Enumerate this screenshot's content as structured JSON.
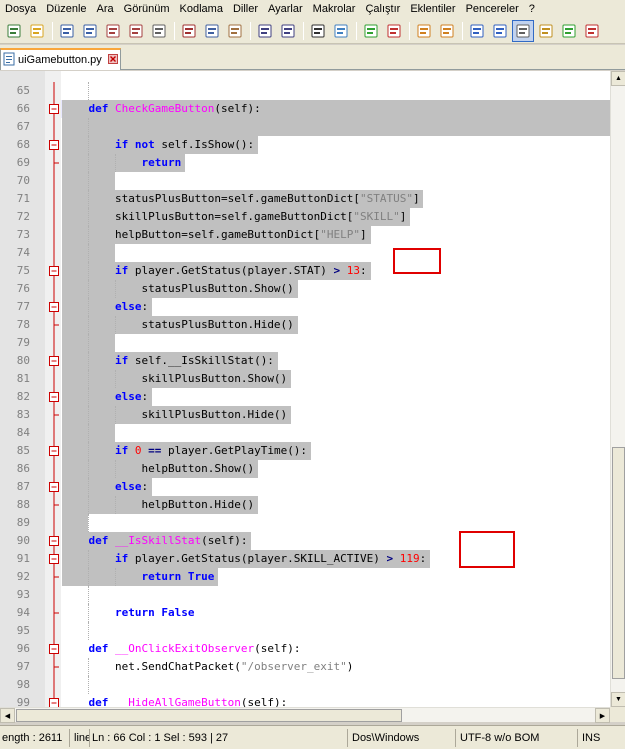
{
  "menu": [
    "Dosya",
    "Düzenle",
    "Ara",
    "Görünüm",
    "Kodlama",
    "Diller",
    "Ayarlar",
    "Makrolar",
    "Çalıştır",
    "Eklentiler",
    "Pencereler",
    "?"
  ],
  "toolbar_icons": [
    "new-file-icon",
    "open-file-icon",
    "save-icon",
    "save-all-icon",
    "close-icon",
    "close-all-icon",
    "print-icon",
    "cut-icon",
    "copy-icon",
    "paste-icon",
    "undo-icon",
    "redo-icon",
    "find-icon",
    "replace-icon",
    "zoom-in-icon",
    "zoom-out-icon",
    "sync-v-icon",
    "sync-h-icon",
    "wrap-icon",
    "show-all-chars-icon",
    "indent-guide-icon",
    "doc-map-icon",
    "function-list-icon",
    "record-macro-icon"
  ],
  "tab": {
    "label": "uiGamebutton.py"
  },
  "lines": [
    {
      "n": "65",
      "fold": "line",
      "tokens": []
    },
    {
      "n": "66",
      "fold": "box",
      "tokens": [
        [
          "    ",
          "txt"
        ],
        [
          "def ",
          "kw"
        ],
        [
          "CheckGameButton",
          "fn"
        ],
        [
          "(self):",
          "txt"
        ]
      ]
    },
    {
      "n": "67",
      "fold": "line",
      "tokens": []
    },
    {
      "n": "68",
      "fold": "box",
      "tokens": [
        [
          "        ",
          "txt"
        ],
        [
          "if ",
          "kw"
        ],
        [
          "not ",
          "kw"
        ],
        [
          "self.IsShow():",
          "txt"
        ]
      ]
    },
    {
      "n": "69",
      "fold": "end",
      "tokens": [
        [
          "            ",
          "txt"
        ],
        [
          "return",
          "kw"
        ]
      ]
    },
    {
      "n": "70",
      "fold": "line",
      "tokens": []
    },
    {
      "n": "71",
      "fold": "line",
      "tokens": [
        [
          "        ",
          "txt"
        ],
        [
          "statusPlusButton=self.gameButtonDict[",
          "txt"
        ],
        [
          "\"STATUS\"",
          "str"
        ],
        [
          "]",
          "txt"
        ]
      ]
    },
    {
      "n": "72",
      "fold": "line",
      "tokens": [
        [
          "        ",
          "txt"
        ],
        [
          "skillPlusButton=self.gameButtonDict[",
          "txt"
        ],
        [
          "\"SKILL\"",
          "str"
        ],
        [
          "]",
          "txt"
        ]
      ]
    },
    {
      "n": "73",
      "fold": "line",
      "tokens": [
        [
          "        ",
          "txt"
        ],
        [
          "helpButton=self.gameButtonDict[",
          "txt"
        ],
        [
          "\"HELP\"",
          "str"
        ],
        [
          "]",
          "txt"
        ]
      ]
    },
    {
      "n": "74",
      "fold": "line",
      "tokens": []
    },
    {
      "n": "75",
      "fold": "box",
      "tokens": [
        [
          "        ",
          "txt"
        ],
        [
          "if ",
          "kw"
        ],
        [
          "player.GetStatus(player.STAT) ",
          "txt"
        ],
        [
          ">",
          "op"
        ],
        [
          " ",
          "txt"
        ],
        [
          "13",
          "num"
        ],
        [
          ":",
          "txt"
        ]
      ]
    },
    {
      "n": "76",
      "fold": "line",
      "tokens": [
        [
          "            ",
          "txt"
        ],
        [
          "statusPlusButton.Show()",
          "txt"
        ]
      ]
    },
    {
      "n": "77",
      "fold": "box",
      "tokens": [
        [
          "        ",
          "txt"
        ],
        [
          "else",
          "kw"
        ],
        [
          ":",
          "txt"
        ]
      ]
    },
    {
      "n": "78",
      "fold": "end",
      "tokens": [
        [
          "            ",
          "txt"
        ],
        [
          "statusPlusButton.Hide()",
          "txt"
        ]
      ]
    },
    {
      "n": "79",
      "fold": "line",
      "tokens": []
    },
    {
      "n": "80",
      "fold": "box",
      "tokens": [
        [
          "        ",
          "txt"
        ],
        [
          "if ",
          "kw"
        ],
        [
          "self.__IsSkillStat():",
          "txt"
        ]
      ]
    },
    {
      "n": "81",
      "fold": "line",
      "tokens": [
        [
          "            ",
          "txt"
        ],
        [
          "skillPlusButton.Show()",
          "txt"
        ]
      ]
    },
    {
      "n": "82",
      "fold": "box",
      "tokens": [
        [
          "        ",
          "txt"
        ],
        [
          "else",
          "kw"
        ],
        [
          ":",
          "txt"
        ]
      ]
    },
    {
      "n": "83",
      "fold": "end",
      "tokens": [
        [
          "            ",
          "txt"
        ],
        [
          "skillPlusButton.Hide()",
          "txt"
        ]
      ]
    },
    {
      "n": "84",
      "fold": "line",
      "tokens": []
    },
    {
      "n": "85",
      "fold": "box",
      "tokens": [
        [
          "        ",
          "txt"
        ],
        [
          "if ",
          "kw"
        ],
        [
          "0",
          "num"
        ],
        [
          " ",
          "txt"
        ],
        [
          "==",
          "op"
        ],
        [
          " player.GetPlayTime():",
          "txt"
        ]
      ]
    },
    {
      "n": "86",
      "fold": "line",
      "tokens": [
        [
          "            ",
          "txt"
        ],
        [
          "helpButton.Show()",
          "txt"
        ]
      ]
    },
    {
      "n": "87",
      "fold": "box",
      "tokens": [
        [
          "        ",
          "txt"
        ],
        [
          "else",
          "kw"
        ],
        [
          ":",
          "txt"
        ]
      ]
    },
    {
      "n": "88",
      "fold": "end",
      "tokens": [
        [
          "            ",
          "txt"
        ],
        [
          "helpButton.Hide()",
          "txt"
        ]
      ]
    },
    {
      "n": "89",
      "fold": "line",
      "tokens": []
    },
    {
      "n": "90",
      "fold": "box",
      "tokens": [
        [
          "    ",
          "txt"
        ],
        [
          "def ",
          "kw"
        ],
        [
          "__IsSkillStat",
          "fn"
        ],
        [
          "(self):",
          "txt"
        ]
      ]
    },
    {
      "n": "91",
      "fold": "box",
      "tokens": [
        [
          "        ",
          "txt"
        ],
        [
          "if ",
          "kw"
        ],
        [
          "player.GetStatus(player.SKILL_ACTIVE) ",
          "txt"
        ],
        [
          ">",
          "op"
        ],
        [
          " ",
          "txt"
        ],
        [
          "119",
          "num"
        ],
        [
          ":",
          "txt"
        ]
      ]
    },
    {
      "n": "92",
      "fold": "end",
      "tokens": [
        [
          "            ",
          "txt"
        ],
        [
          "return ",
          "kw"
        ],
        [
          "True",
          "kw"
        ]
      ]
    },
    {
      "n": "93",
      "fold": "line",
      "tokens": []
    },
    {
      "n": "94",
      "fold": "end",
      "tokens": [
        [
          "        ",
          "txt"
        ],
        [
          "return ",
          "kw"
        ],
        [
          "False",
          "kw"
        ]
      ]
    },
    {
      "n": "95",
      "fold": "line",
      "tokens": []
    },
    {
      "n": "96",
      "fold": "box",
      "tokens": [
        [
          "    ",
          "txt"
        ],
        [
          "def ",
          "kw"
        ],
        [
          "__OnClickExitObserver",
          "fn"
        ],
        [
          "(self):",
          "txt"
        ]
      ]
    },
    {
      "n": "97",
      "fold": "end",
      "tokens": [
        [
          "        ",
          "txt"
        ],
        [
          "net.SendChatPacket(",
          "txt"
        ],
        [
          "\"/observer_exit\"",
          "str"
        ],
        [
          ")",
          "txt"
        ]
      ]
    },
    {
      "n": "98",
      "fold": "line",
      "tokens": []
    },
    {
      "n": "99",
      "fold": "box",
      "tokens": [
        [
          "    ",
          "txt"
        ],
        [
          "def ",
          "kw"
        ],
        [
          "__HideAllGameButton",
          "fn"
        ],
        [
          "(self):",
          "txt"
        ]
      ]
    }
  ],
  "status": {
    "length": "ength : 2611",
    "lines": "line",
    "position": "Ln : 66    Col : 1    Sel : 593 | 27",
    "eol": "Dos\\Windows",
    "encoding": "UTF-8 w/o BOM",
    "mode": "INS"
  },
  "colors": {
    "keyword": "#0000ff",
    "function": "#ff00ff",
    "string": "#808080",
    "number": "#ff0000",
    "selection": "#c0c0c0",
    "highlight_box": "#e00000",
    "fold_marker": "#cc0000"
  }
}
